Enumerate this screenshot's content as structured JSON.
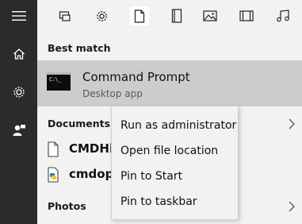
{
  "rail": {
    "items": [
      {
        "icon": "hamburger-menu-icon"
      },
      {
        "icon": "home-icon"
      },
      {
        "icon": "gear-icon"
      },
      {
        "icon": "user-feedback-icon"
      }
    ]
  },
  "toolbar": {
    "filters": [
      {
        "icon": "apps-icon"
      },
      {
        "icon": "settings-gear-icon"
      },
      {
        "icon": "document-icon",
        "selected": true
      },
      {
        "icon": "folder-icon"
      },
      {
        "icon": "photo-icon"
      },
      {
        "icon": "video-icon"
      },
      {
        "icon": "music-icon"
      }
    ]
  },
  "best_match": {
    "heading": "Best match",
    "title": "Command Prompt",
    "subtitle": "Desktop app",
    "icon_text": "C:\\_"
  },
  "documents": {
    "heading": "Documents",
    "items": [
      {
        "label": "CMDHis",
        "icon": "file-icon"
      },
      {
        "label": "cmdopt",
        "icon": "python-file-icon"
      }
    ]
  },
  "photos": {
    "heading": "Photos"
  },
  "context_menu": {
    "items": [
      {
        "label": "Run as administrator"
      },
      {
        "label": "Open file location"
      },
      {
        "label": "Pin to Start"
      },
      {
        "label": "Pin to taskbar"
      }
    ]
  },
  "colors": {
    "rail_bg": "#2b2b2b",
    "panel_bg": "#f2f2f2",
    "highlight_bg": "#cccccc"
  }
}
